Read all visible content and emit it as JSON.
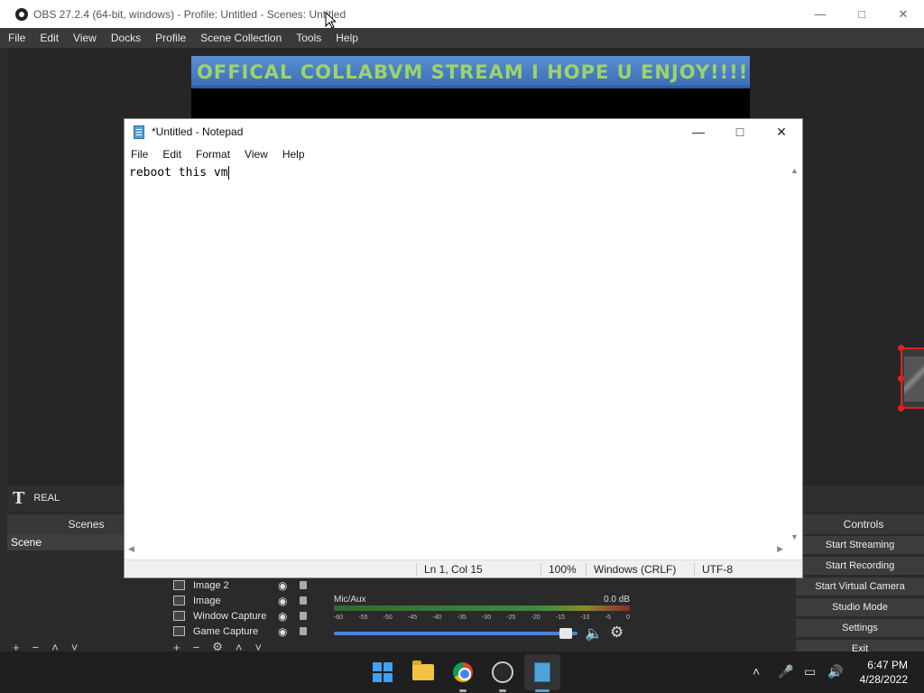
{
  "obs": {
    "title": "OBS 27.2.4 (64-bit, windows) - Profile: Untitled - Scenes: Untitled",
    "menu": [
      "File",
      "Edit",
      "View",
      "Docks",
      "Profile",
      "Scene Collection",
      "Tools",
      "Help"
    ],
    "marquee_text": "OFFICAL COLLABVM STREAM I HOPE U ENJOY!!!!! WE",
    "source_label": "REAL",
    "scenes_header": "Scenes",
    "scene_item": "Scene",
    "sources": [
      "Image 2",
      "Image",
      "Window Capture",
      "Game Capture"
    ],
    "mixer": {
      "name": "Mic/Aux",
      "db": "0.0 dB",
      "ticks": [
        "-60",
        "-55",
        "-50",
        "-45",
        "-40",
        "-35",
        "-30",
        "-25",
        "-20",
        "-15",
        "-10",
        "-5",
        "0"
      ]
    },
    "controls_header": "Controls",
    "controls": [
      "Start Streaming",
      "Start Recording",
      "Start Virtual Camera",
      "Studio Mode",
      "Settings",
      "Exit"
    ]
  },
  "notepad": {
    "title": "*Untitled - Notepad",
    "menu": [
      "File",
      "Edit",
      "Format",
      "View",
      "Help"
    ],
    "content": "reboot this vm",
    "status": {
      "position": "Ln 1, Col 15",
      "zoom": "100%",
      "line_ending": "Windows (CRLF)",
      "encoding": "UTF-8"
    }
  },
  "taskbar": {
    "time": "6:47 PM",
    "date": "4/28/2022"
  }
}
